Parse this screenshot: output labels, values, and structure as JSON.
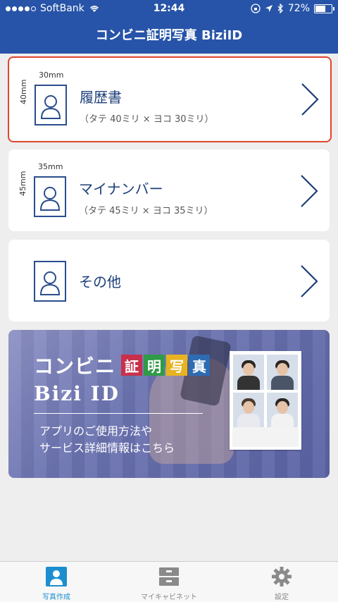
{
  "status": {
    "carrier": "SoftBank",
    "time": "12:44",
    "battery": "72%",
    "battery_level": 0.72
  },
  "nav": {
    "title": "コンビニ証明写真 BiziID"
  },
  "cards": [
    {
      "title": "履歴書",
      "subtitle": "（タテ 40ミリ × ヨコ 30ミリ）",
      "width_label": "30mm",
      "height_label": "40mm",
      "selected": true
    },
    {
      "title": "マイナンバー",
      "subtitle": "（タテ 45ミリ × ヨコ 35ミリ）",
      "width_label": "35mm",
      "height_label": "45mm",
      "selected": false
    },
    {
      "title": "その他",
      "subtitle": "",
      "width_label": "",
      "height_label": "",
      "selected": false
    }
  ],
  "banner": {
    "logo_text": "コンビニ",
    "logo_kanji": [
      "証",
      "明",
      "写",
      "真"
    ],
    "logo_kanji_colors": [
      "#c8304b",
      "#2f9b48",
      "#e8b320",
      "#2d6bb3"
    ],
    "product": "Bizi ID",
    "desc_line1": "アプリのご使用方法や",
    "desc_line2": "サービス詳細情報はこちら"
  },
  "tabs": [
    {
      "label": "写真作成",
      "icon": "person-photo-icon",
      "active": true
    },
    {
      "label": "マイキャビネット",
      "icon": "cabinet-icon",
      "active": false
    },
    {
      "label": "設定",
      "icon": "gear-icon",
      "active": false
    }
  ],
  "colors": {
    "nav_bg": "#2754a8",
    "selected_border": "#e0452f",
    "accent": "#1b8ed0",
    "card_text": "#1d3f7a"
  }
}
